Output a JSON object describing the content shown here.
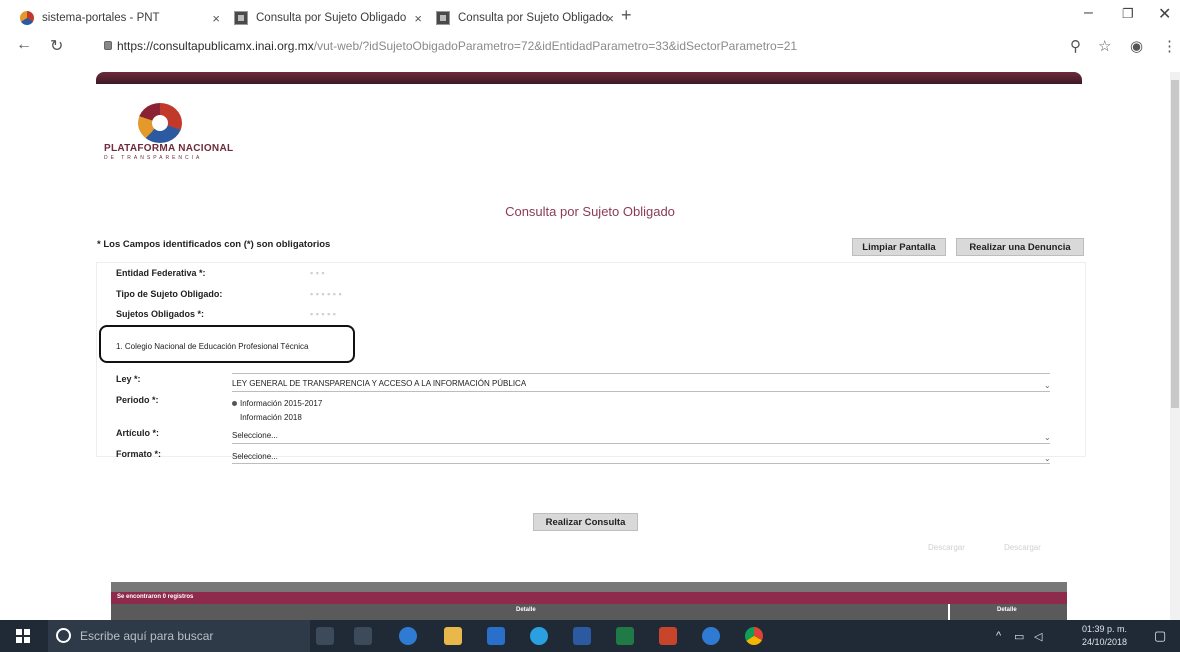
{
  "browser": {
    "tabs": [
      {
        "title": "sistema-portales - PNT",
        "favicon": "pnt-logo-icon"
      },
      {
        "title": "Consulta por Sujeto Obligado",
        "favicon": "document-icon"
      },
      {
        "title": "Consulta por Sujeto Obligado",
        "favicon": "document-icon",
        "active": true
      }
    ],
    "close_glyph": "×",
    "newtab_glyph": "+",
    "url_host": "https://consultapublicamx.inai.org.mx",
    "url_path": "/vut-web/?idSujetoObigadoParametro=72&idEntidadParametro=33&idSectorParametro=21"
  },
  "page": {
    "logo_text": "PLATAFORMA NACIONAL",
    "logo_subtext": "DE TRANSPARENCIA",
    "title": "Consulta por Sujeto Obligado",
    "required_note": "* Los Campos identificados con (*) son obligatorios",
    "buttons": {
      "clear": "Limpiar Pantalla",
      "complaint": "Realizar una Denuncia",
      "query": "Realizar Consulta"
    },
    "fields": {
      "entidad_label": "Entidad Federativa *:",
      "tipo_label": "Tipo de Sujeto Obligado:",
      "sujetos_label": "Sujetos Obligados *:",
      "sujeto_selected": "1. Colegio Nacional de Educación Profesional Técnica",
      "ley_label": "Ley *:",
      "ley_value": "LEY GENERAL DE TRANSPARENCIA Y ACCESO A LA INFORMACIÓN PÚBLICA",
      "periodo_label": "Periodo *:",
      "periodo_options": [
        "Información 2015-2017",
        "Información 2018"
      ],
      "articulo_label": "Artículo *:",
      "articulo_value": "Seleccione...",
      "formato_label": "Formato *:",
      "formato_value": "Seleccione..."
    },
    "download_labels": [
      "Descargar",
      "Descargar"
    ],
    "results": {
      "count_text": "Se encontraron 0 registros",
      "col_detail_1": "Detalle",
      "col_detail_2": "Detalle"
    }
  },
  "taskbar": {
    "search_placeholder": "Escribe aquí para buscar",
    "time": "01:39 p. m.",
    "date": "24/10/2018"
  },
  "colors": {
    "brand": "#8b3a57",
    "topbar": "#6d2b3c",
    "results_header": "#8e2a4b",
    "taskbar": "#1f2a36"
  }
}
